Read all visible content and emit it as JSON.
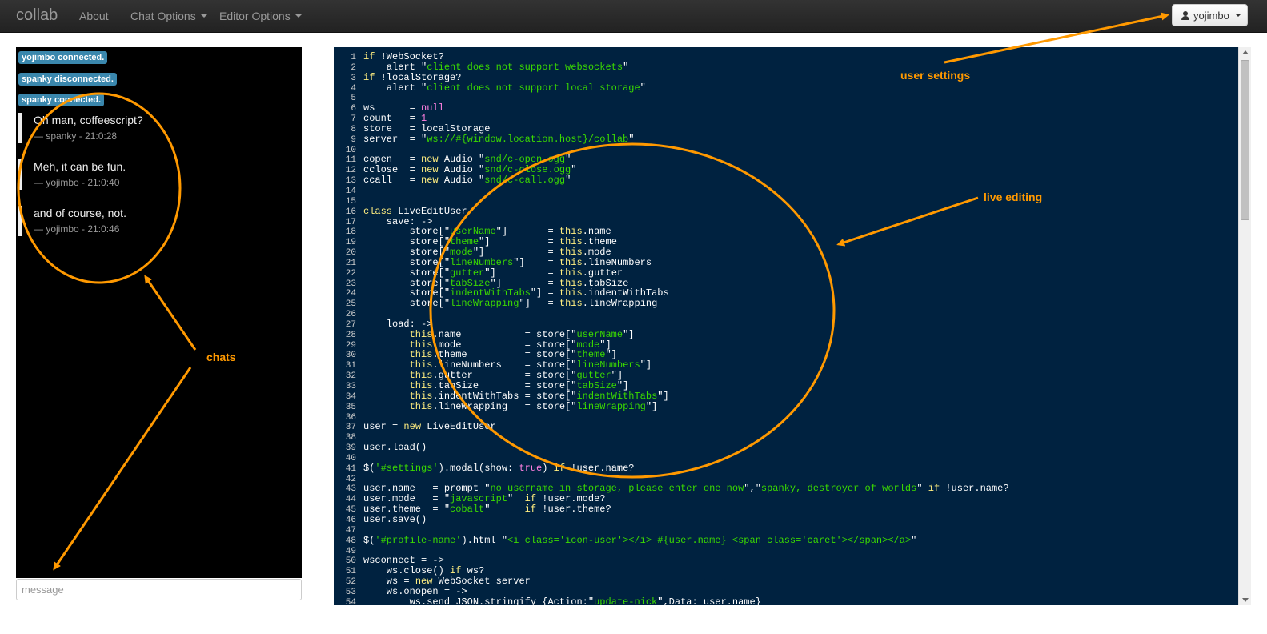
{
  "navbar": {
    "brand": "collab",
    "items": [
      {
        "label": "About",
        "dropdown": false
      },
      {
        "label": "Chat Options",
        "dropdown": true
      },
      {
        "label": "Editor Options",
        "dropdown": true
      }
    ],
    "user": "yojimbo"
  },
  "chat": {
    "statuses": [
      "yojimbo connected.",
      "spanky disconnected.",
      "spanky connected."
    ],
    "messages": [
      {
        "text": "Oh man, coffeescript?",
        "meta": "— spanky - 21:0:28"
      },
      {
        "text": "Meh, it can be fun.",
        "meta": "— yojimbo - 21:0:40"
      },
      {
        "text": "and of course, not.",
        "meta": "— yojimbo - 21:0:46"
      }
    ],
    "input_placeholder": "message"
  },
  "editor": {
    "theme_colors": {
      "background": "#002240",
      "string": "#3ad900",
      "number": "#ff80e1",
      "keyword": "#ffee80"
    },
    "lines": [
      "if !WebSocket?",
      "    alert \"client does not support websockets\"",
      "if !localStorage?",
      "    alert \"client does not support local storage\"",
      "",
      "ws      = null",
      "count   = 1",
      "store   = localStorage",
      "server  = \"ws://#{window.location.host}/collab\"",
      "",
      "copen   = new Audio \"snd/c-open.ogg\"",
      "cclose  = new Audio \"snd/c-close.ogg\"",
      "ccall   = new Audio \"snd/c-call.ogg\"",
      "",
      "",
      "class LiveEditUser",
      "    save: ->",
      "        store[\"userName\"]       = this.name",
      "        store[\"theme\"]          = this.theme",
      "        store[\"mode\"]           = this.mode",
      "        store[\"lineNumbers\"]    = this.lineNumbers",
      "        store[\"gutter\"]         = this.gutter",
      "        store[\"tabSize\"]        = this.tabSize",
      "        store[\"indentWithTabs\"] = this.indentWithTabs",
      "        store[\"lineWrapping\"]   = this.lineWrapping",
      "",
      "    load: ->",
      "        this.name           = store[\"userName\"]",
      "        this.mode           = store[\"mode\"]",
      "        this.theme          = store[\"theme\"]",
      "        this.lineNumbers    = store[\"lineNumbers\"]",
      "        this.gutter         = store[\"gutter\"]",
      "        this.tabSize        = store[\"tabSize\"]",
      "        this.indentWithTabs = store[\"indentWithTabs\"]",
      "        this.lineWrapping   = store[\"lineWrapping\"]",
      "",
      "user = new LiveEditUser",
      "",
      "user.load()",
      "",
      "$('#settings').modal(show: true) if !user.name?",
      "",
      "user.name   = prompt \"no username in storage, please enter one now\",\"spanky, destroyer of worlds\" if !user.name?",
      "user.mode   = \"javascript\"  if !user.mode?",
      "user.theme  = \"cobalt\"      if !user.theme?",
      "user.save()",
      "",
      "$('#profile-name').html \"<i class='icon-user'></i> #{user.name} <span class='caret'></span></a>\"",
      "",
      "wsconnect = ->",
      "    ws.close() if ws?",
      "    ws = new WebSocket server",
      "    ws.onopen = ->",
      "        ws.send JSON.stringify {Action:\"update-nick\",Data: user.name}"
    ]
  },
  "annotations": {
    "user_settings": "user settings",
    "live_editing": "live editing",
    "chats": "chats",
    "color": "#ff9900"
  }
}
